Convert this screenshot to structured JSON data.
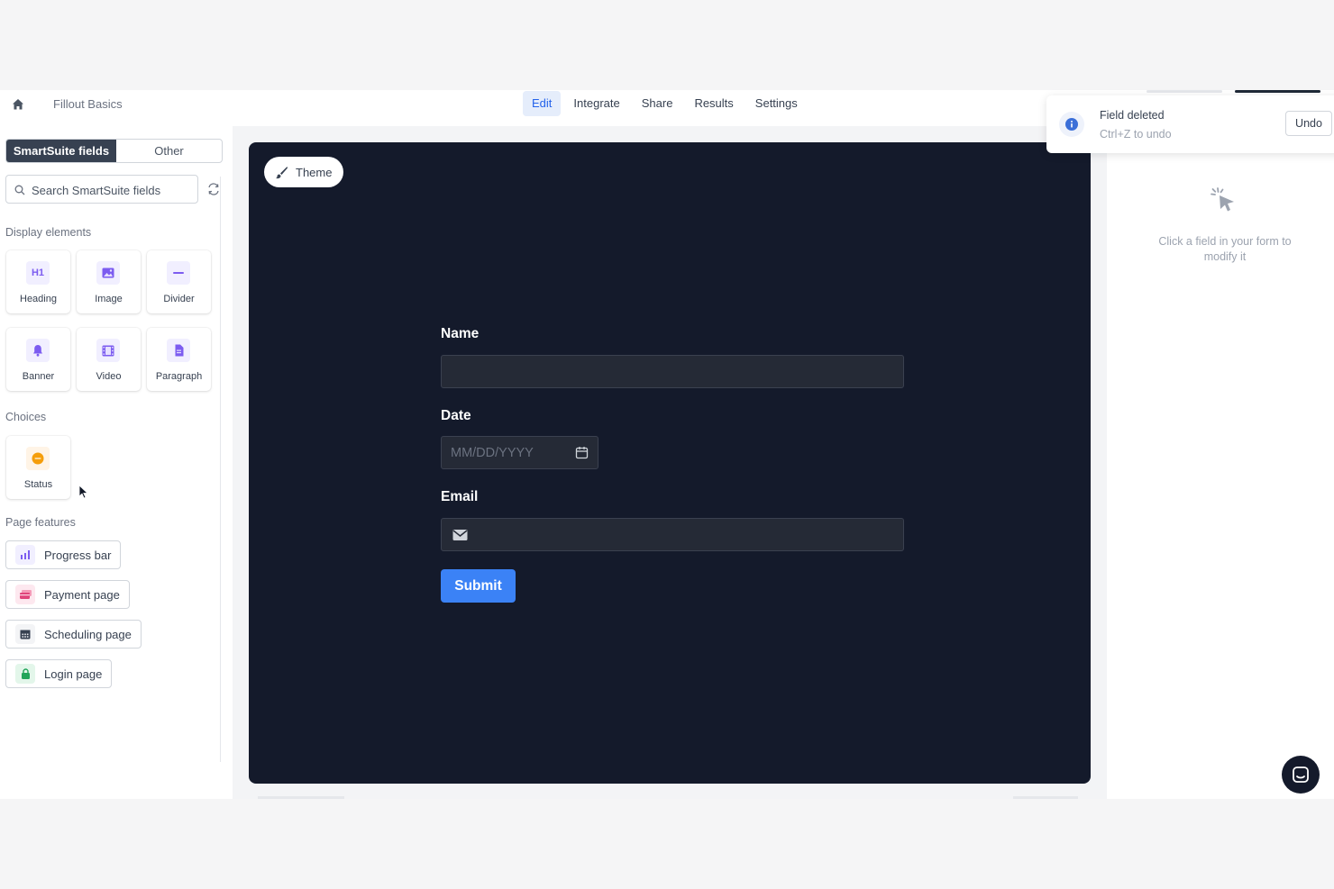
{
  "topbar": {
    "app_title": "Fillout Basics",
    "tabs": [
      {
        "label": "Edit",
        "active": true
      },
      {
        "label": "Integrate",
        "active": false
      },
      {
        "label": "Share",
        "active": false
      },
      {
        "label": "Results",
        "active": false
      },
      {
        "label": "Settings",
        "active": false
      }
    ]
  },
  "sidebar": {
    "segments": [
      "SmartSuite fields",
      "Other"
    ],
    "search_placeholder": "Search SmartSuite fields",
    "display_label": "Display elements",
    "display_items": [
      {
        "label": "Heading",
        "icon": "heading-icon"
      },
      {
        "label": "Image",
        "icon": "image-icon"
      },
      {
        "label": "Divider",
        "icon": "divider-icon"
      },
      {
        "label": "Banner",
        "icon": "bell-icon"
      },
      {
        "label": "Video",
        "icon": "film-icon"
      },
      {
        "label": "Paragraph",
        "icon": "document-icon"
      }
    ],
    "heading_glyph": "H1",
    "choices_label": "Choices",
    "choice_items": [
      {
        "label": "Status",
        "icon": "status-icon"
      }
    ],
    "page_features_label": "Page features",
    "features": [
      {
        "label": "Progress bar",
        "icon": "bar-chart-icon",
        "color": "#7c5cf0"
      },
      {
        "label": "Payment page",
        "icon": "credit-card-icon",
        "color": "#e0457b"
      },
      {
        "label": "Scheduling page",
        "icon": "calendar-icon",
        "color": "#374151"
      },
      {
        "label": "Login page",
        "icon": "lock-icon",
        "color": "#22a55a"
      }
    ]
  },
  "canvas": {
    "theme_label": "Theme",
    "fields": [
      {
        "label": "Name"
      },
      {
        "label": "Date",
        "placeholder": "MM/DD/YYYY"
      },
      {
        "label": "Email"
      }
    ],
    "submit_label": "Submit",
    "background": "#141a2b",
    "accent": "#3b82f6"
  },
  "right_panel": {
    "hint": "Click a field in your form to modify it"
  },
  "toast": {
    "title": "Field deleted",
    "subtitle": "Ctrl+Z to undo",
    "action": "Undo"
  }
}
